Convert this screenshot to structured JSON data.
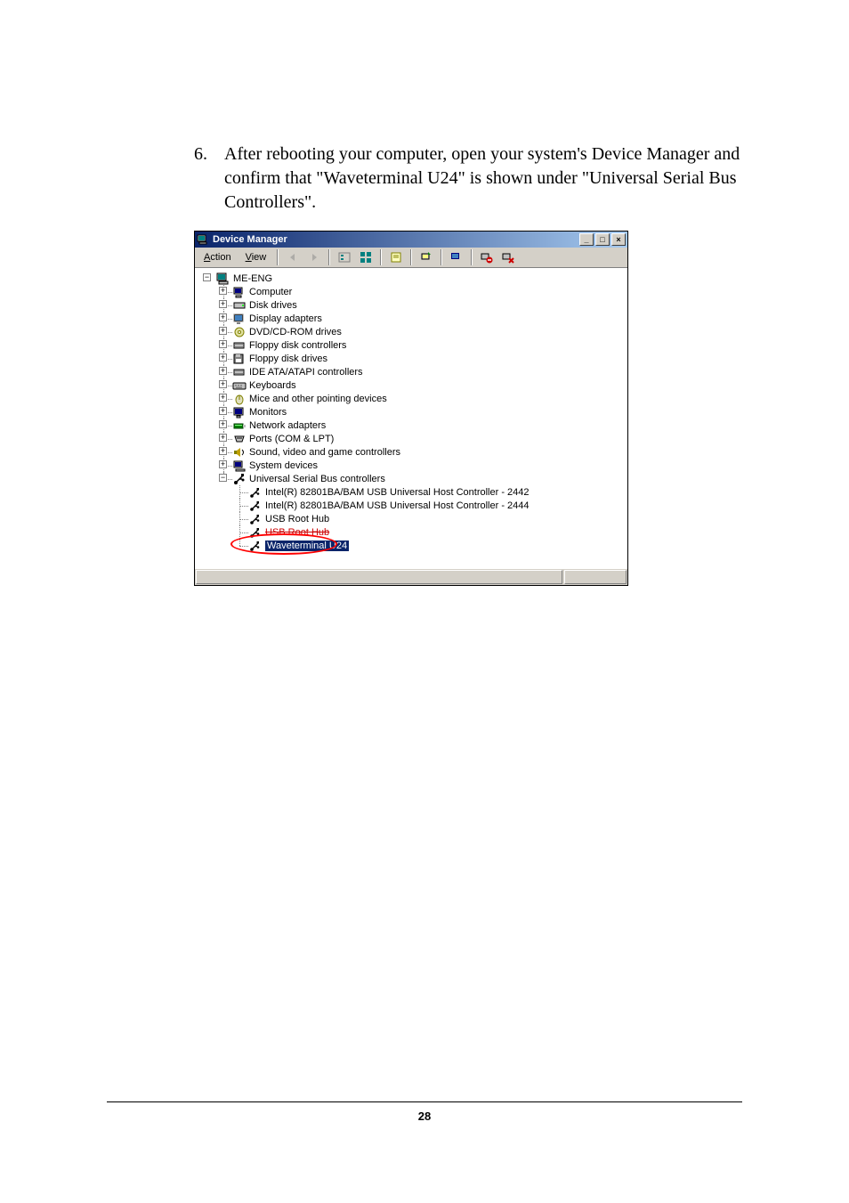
{
  "instruction": {
    "number": "6.",
    "text": "After rebooting your computer, open your system's Device Manager and confirm that \"Waveterminal U24\" is shown under \"Universal Serial Bus Controllers\"."
  },
  "page_number": "28",
  "window": {
    "title": "Device Manager",
    "menus": {
      "action": "Action",
      "view": "View"
    },
    "win_buttons": {
      "min": "_",
      "max": "□",
      "close": "×"
    }
  },
  "tree": {
    "root": "ME-ENG",
    "categories": [
      {
        "label": "Computer",
        "icon": "computer"
      },
      {
        "label": "Disk drives",
        "icon": "disk"
      },
      {
        "label": "Display adapters",
        "icon": "display"
      },
      {
        "label": "DVD/CD-ROM drives",
        "icon": "cd"
      },
      {
        "label": "Floppy disk controllers",
        "icon": "controller"
      },
      {
        "label": "Floppy disk drives",
        "icon": "floppy"
      },
      {
        "label": "IDE ATA/ATAPI controllers",
        "icon": "controller"
      },
      {
        "label": "Keyboards",
        "icon": "keyboard"
      },
      {
        "label": "Mice and other pointing devices",
        "icon": "mouse"
      },
      {
        "label": "Monitors",
        "icon": "monitor"
      },
      {
        "label": "Network adapters",
        "icon": "network"
      },
      {
        "label": "Ports (COM & LPT)",
        "icon": "port"
      },
      {
        "label": "Sound, video and game controllers",
        "icon": "sound"
      },
      {
        "label": "System devices",
        "icon": "system"
      },
      {
        "label": "Universal Serial Bus controllers",
        "icon": "usb",
        "expanded": true
      }
    ],
    "usb_children": [
      {
        "label": "Intel(R) 82801BA/BAM USB Universal Host Controller - 2442",
        "style": "normal"
      },
      {
        "label": "Intel(R) 82801BA/BAM USB Universal Host Controller - 2444",
        "style": "normal"
      },
      {
        "label": "USB Root Hub",
        "style": "normal"
      },
      {
        "label": "USB Root Hub",
        "style": "strike"
      },
      {
        "label": "Waveterminal U24",
        "style": "selected"
      }
    ]
  }
}
